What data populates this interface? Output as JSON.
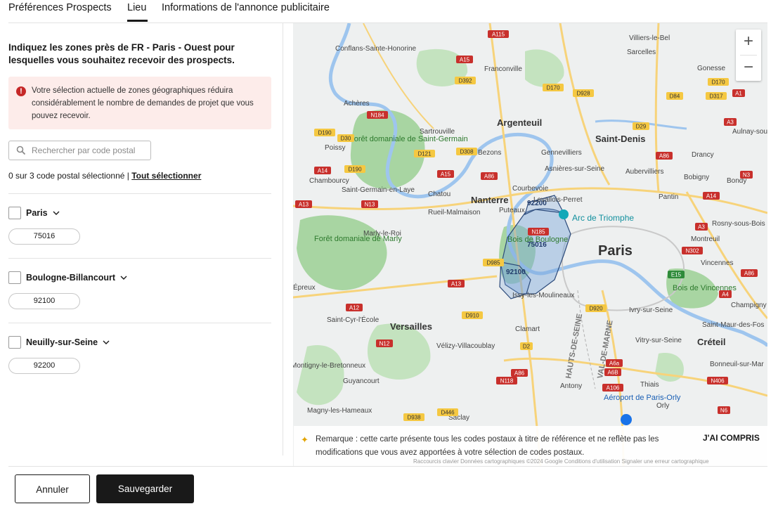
{
  "tabs": [
    {
      "label": "Préférences Prospects"
    },
    {
      "label": "Lieu"
    },
    {
      "label": "Informations de l'annonce publicitaire"
    }
  ],
  "heading": "Indiquez les zones près de FR - Paris - Ouest pour lesquelles vous souhaitez recevoir des prospects.",
  "alert": {
    "text": "Votre sélection actuelle de zones géographiques réduira considérablement le nombre de demandes de projet que vous pouvez recevoir.",
    "color": "#fdecea"
  },
  "search": {
    "placeholder": "Rechercher par code postal",
    "value": ""
  },
  "counter": {
    "text": "0 sur 3 code postal sélectionné | ",
    "select_all": "Tout sélectionner"
  },
  "groups": [
    {
      "label": "Paris",
      "checked": false,
      "codes": [
        "75016"
      ]
    },
    {
      "label": "Boulogne-Billancourt",
      "checked": false,
      "codes": [
        "92100"
      ]
    },
    {
      "label": "Neuilly-sur-Seine",
      "checked": false,
      "codes": [
        "92200"
      ]
    }
  ],
  "map": {
    "zoom_in": "+",
    "zoom_out": "−",
    "labels": {
      "paris": "Paris",
      "nanterre": "Nanterre",
      "versailles": "Versailles",
      "argenteuil": "Argenteuil",
      "saint_denis": "Saint-Denis",
      "creteil": "Créteil",
      "arc": "Arc de Triomphe",
      "bois_boulogne": "Bois de Boulogne",
      "bois_vincennes": "Bois de Vincennes",
      "foret_st_germain": "Forêt domaniale de Saint-Germain",
      "foret_marly": "Forêt domaniale de Marly",
      "aeroport": "Aéroport de Paris-Orly",
      "hauts_de_seine": "HAUTS-DE-SEINE",
      "val_de_marne": "VAL-DE-MARNE",
      "zone_75016": "75016",
      "zone_92100": "92100",
      "zone_92200": "92200",
      "towns": [
        "Conflans-Sainte-Honorine",
        "Franconville",
        "Villiers-le-Bel",
        "Sarcelles",
        "Gonesse",
        "Achères",
        "Poissy",
        "Sartrouville",
        "Bezons",
        "Gennevilliers",
        "Asnières-sur-Seine",
        "Aubervilliers",
        "Drancy",
        "Bobigny",
        "Bondy",
        "Aulnay-sous-B",
        "Chambourcy",
        "Saint-Germain-en-Laye",
        "Chatou",
        "Rueil-Malmaison",
        "Courbevoie",
        "Levallois-Perret",
        "Puteaux",
        "Pantin",
        "Rosny-sous-Bois",
        "Marly-le-Roi",
        "Montreuil",
        "Vincennes",
        "Issy-les-Moulineaux",
        "Ivry-sur-Seine",
        "Champigny",
        "Saint-Cyr-l'École",
        "Clamart",
        "Saint-Maur-des-Fos",
        "Vélizy-Villacoublay",
        "Vitry-sur-Seine",
        "Bonneuil-sur-Mar",
        "Guyancourt",
        "Antony",
        "Thiais",
        "Orly",
        "Magny-les-Hameaux",
        "Saclay",
        "Montigny-le-Bretonneux",
        "Épreux"
      ]
    },
    "roads": [
      "A115",
      "A15",
      "N184",
      "D392",
      "D170",
      "D928",
      "A1",
      "D84",
      "D317",
      "D170",
      "D190",
      "D30",
      "D121",
      "D308",
      "A15",
      "D29",
      "A86",
      "A3",
      "D190",
      "A14",
      "A86",
      "A14",
      "A13",
      "N13",
      "N185",
      "A3",
      "N3",
      "N302",
      "E15",
      "A86",
      "A4",
      "D985",
      "A13",
      "A12",
      "D910",
      "D920",
      "N12",
      "D2",
      "A86",
      "N118",
      "A6a",
      "A6B",
      "A106",
      "N406",
      "D938",
      "D446",
      "N6"
    ],
    "note": "Remarque : cette carte présente tous les codes postaux à titre de référence et ne reflète pas les modifications que vous avez apportées à votre sélection de codes postaux.",
    "note_button": "J'AI COMPRIS",
    "attribution": "Raccourcis clavier   Données cartographiques ©2024 Google   Conditions d'utilisation   Signaler une erreur cartographique"
  },
  "footer": {
    "cancel": "Annuler",
    "save": "Sauvegarder"
  },
  "colors": {
    "primary": "#191919",
    "zone_fill": "#7aa7d9",
    "zone_stroke": "#2c4a7a",
    "alert_icon": "#c62828"
  }
}
